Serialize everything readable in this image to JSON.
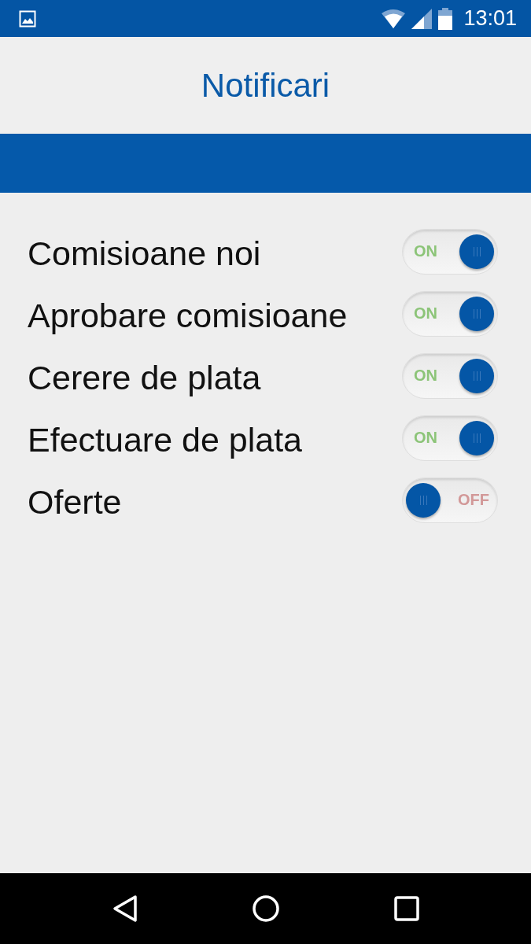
{
  "status_bar": {
    "time": "13:01"
  },
  "header": {
    "title": "Notificari"
  },
  "settings": [
    {
      "label": "Comisioane noi",
      "on": true,
      "state_text": "ON"
    },
    {
      "label": "Aprobare comisioane",
      "on": true,
      "state_text": "ON"
    },
    {
      "label": "Cerere de plata",
      "on": true,
      "state_text": "ON"
    },
    {
      "label": "Efectuare de plata",
      "on": true,
      "state_text": "ON"
    },
    {
      "label": "Oferte",
      "on": false,
      "state_text": "OFF"
    }
  ]
}
